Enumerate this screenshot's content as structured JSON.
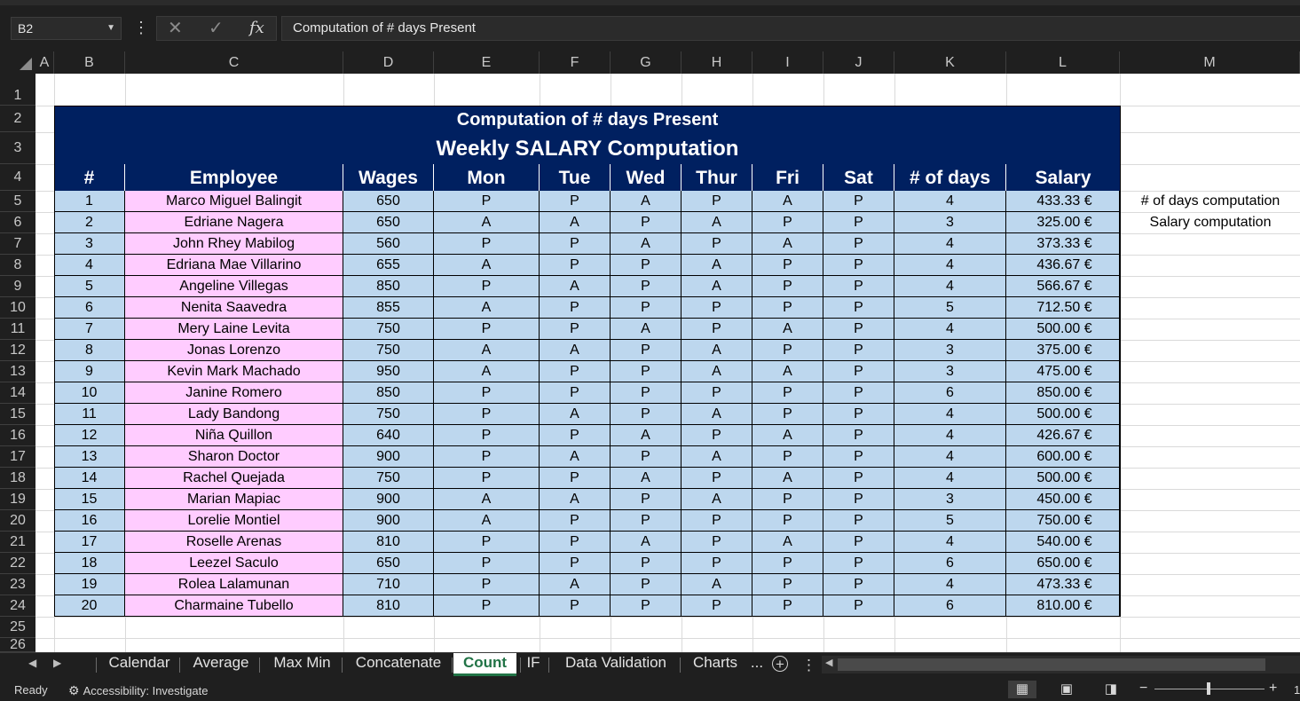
{
  "formula_bar": {
    "name_box": "B2",
    "formula": "Computation of # days Present"
  },
  "columns": [
    "A",
    "B",
    "C",
    "D",
    "E",
    "F",
    "G",
    "H",
    "I",
    "J",
    "K",
    "L",
    "M"
  ],
  "rows": [
    "1",
    "2",
    "3",
    "4",
    "5",
    "6",
    "7",
    "8",
    "9",
    "10",
    "11",
    "12",
    "13",
    "14",
    "15",
    "16",
    "17",
    "18",
    "19",
    "20",
    "21",
    "22",
    "23",
    "24",
    "25",
    "26"
  ],
  "sheet": {
    "title1": "Computation of # days Present",
    "title2": "Weekly SALARY Computation",
    "headers": [
      "#",
      "Employee",
      "Wages",
      "Mon",
      "Tue",
      "Wed",
      "Thur",
      "Fri",
      "Sat",
      "# of days",
      "Salary"
    ],
    "data": [
      [
        "1",
        "Marco Miguel Balingit",
        "650",
        "P",
        "P",
        "A",
        "P",
        "A",
        "P",
        "4",
        "433.33 €"
      ],
      [
        "2",
        "Edriane Nagera",
        "650",
        "A",
        "A",
        "P",
        "A",
        "P",
        "P",
        "3",
        "325.00 €"
      ],
      [
        "3",
        "John Rhey Mabilog",
        "560",
        "P",
        "P",
        "A",
        "P",
        "A",
        "P",
        "4",
        "373.33 €"
      ],
      [
        "4",
        "Edriana Mae Villarino",
        "655",
        "A",
        "P",
        "P",
        "A",
        "P",
        "P",
        "4",
        "436.67 €"
      ],
      [
        "5",
        "Angeline Villegas",
        "850",
        "P",
        "A",
        "P",
        "A",
        "P",
        "P",
        "4",
        "566.67 €"
      ],
      [
        "6",
        "Nenita Saavedra",
        "855",
        "A",
        "P",
        "P",
        "P",
        "P",
        "P",
        "5",
        "712.50 €"
      ],
      [
        "7",
        "Mery Laine Levita",
        "750",
        "P",
        "P",
        "A",
        "P",
        "A",
        "P",
        "4",
        "500.00 €"
      ],
      [
        "8",
        "Jonas Lorenzo",
        "750",
        "A",
        "A",
        "P",
        "A",
        "P",
        "P",
        "3",
        "375.00 €"
      ],
      [
        "9",
        "Kevin Mark Machado",
        "950",
        "A",
        "P",
        "P",
        "A",
        "A",
        "P",
        "3",
        "475.00 €"
      ],
      [
        "10",
        "Janine Romero",
        "850",
        "P",
        "P",
        "P",
        "P",
        "P",
        "P",
        "6",
        "850.00 €"
      ],
      [
        "11",
        "Lady Bandong",
        "750",
        "P",
        "A",
        "P",
        "A",
        "P",
        "P",
        "4",
        "500.00 €"
      ],
      [
        "12",
        "Niña Quillon",
        "640",
        "P",
        "P",
        "A",
        "P",
        "A",
        "P",
        "4",
        "426.67 €"
      ],
      [
        "13",
        "Sharon Doctor",
        "900",
        "P",
        "A",
        "P",
        "A",
        "P",
        "P",
        "4",
        "600.00 €"
      ],
      [
        "14",
        "Rachel Quejada",
        "750",
        "P",
        "P",
        "A",
        "P",
        "A",
        "P",
        "4",
        "500.00 €"
      ],
      [
        "15",
        "Marian Mapiac",
        "900",
        "A",
        "A",
        "P",
        "A",
        "P",
        "P",
        "3",
        "450.00 €"
      ],
      [
        "16",
        "Lorelie Montiel",
        "900",
        "A",
        "P",
        "P",
        "P",
        "P",
        "P",
        "5",
        "750.00 €"
      ],
      [
        "17",
        "Roselle Arenas",
        "810",
        "P",
        "P",
        "A",
        "P",
        "A",
        "P",
        "4",
        "540.00 €"
      ],
      [
        "18",
        "Leezel Saculo",
        "650",
        "P",
        "P",
        "P",
        "P",
        "P",
        "P",
        "6",
        "650.00 €"
      ],
      [
        "19",
        "Rolea Lalamunan",
        "710",
        "P",
        "A",
        "P",
        "A",
        "P",
        "P",
        "4",
        "473.33 €"
      ],
      [
        "20",
        "Charmaine Tubello",
        "810",
        "P",
        "P",
        "P",
        "P",
        "P",
        "P",
        "6",
        "810.00 €"
      ]
    ],
    "notes": [
      "# of days computation",
      "Salary  computation"
    ]
  },
  "tabs": [
    {
      "label": "Calendar",
      "active": false
    },
    {
      "label": "Average",
      "active": false
    },
    {
      "label": "Max Min",
      "active": false
    },
    {
      "label": "Concatenate",
      "active": false
    },
    {
      "label": "Count",
      "active": true
    },
    {
      "label": "IF",
      "active": false
    },
    {
      "label": "Data Validation",
      "active": false
    },
    {
      "label": "Charts",
      "active": false
    }
  ],
  "more_tabs": "...",
  "status": {
    "ready": "Ready",
    "accessibility": "Accessibility: Investigate",
    "zoom": "1"
  },
  "colors": {
    "header_navy": "#002060",
    "cell_blue": "#bdd7ee",
    "cell_pink": "#ffccff",
    "active_tab": "#217346"
  }
}
